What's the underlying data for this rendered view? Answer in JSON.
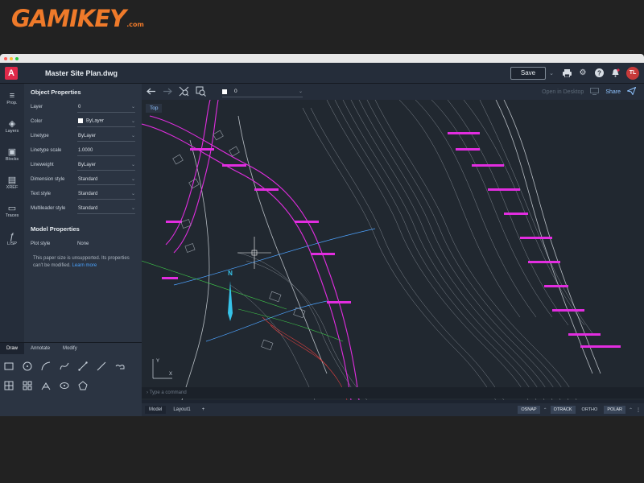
{
  "brand": {
    "logo_main": "GAMIKEY",
    "logo_suffix": ".com"
  },
  "header": {
    "title": "Master Site Plan.dwg",
    "save_label": "Save",
    "save_caret": "⌄",
    "avatar_initials": "TL"
  },
  "rail": {
    "items": [
      {
        "label": "Prop.",
        "icon": "≡"
      },
      {
        "label": "Layers",
        "icon": "◈"
      },
      {
        "label": "Blocks",
        "icon": "▣"
      },
      {
        "label": "XREF",
        "icon": "▤"
      },
      {
        "label": "Traces",
        "icon": "▭"
      },
      {
        "label": "LISP",
        "icon": "ƒ"
      }
    ]
  },
  "properties": {
    "object_title": "Object Properties",
    "rows": [
      {
        "label": "Layer",
        "value": "0"
      },
      {
        "label": "Color",
        "value": "ByLayer"
      },
      {
        "label": "Linetype",
        "value": "ByLayer"
      },
      {
        "label": "Linetype scale",
        "value": "1.0000"
      },
      {
        "label": "Lineweight",
        "value": "ByLayer"
      },
      {
        "label": "Dimension style",
        "value": "Standard"
      },
      {
        "label": "Text style",
        "value": "Standard"
      },
      {
        "label": "Multileader style",
        "value": "Standard"
      }
    ],
    "model_title": "Model Properties",
    "plot_style_label": "Plot style",
    "plot_style_value": "None",
    "note_text": "This paper size is unsupported. Its properties can't be modified.",
    "note_link": "Learn more"
  },
  "draw_panel": {
    "tabs": [
      "Draw",
      "Annotate",
      "Modify"
    ],
    "active_tab": "Draw"
  },
  "viewport": {
    "layer_value": "0",
    "open_desktop": "Open in Desktop",
    "share": "Share",
    "view_label": "Top",
    "north_label": "N",
    "axis_y": "Y",
    "axis_x": "X"
  },
  "command": {
    "placeholder": "Type a command"
  },
  "bottom_bar": {
    "tabs": [
      "Model",
      "Layout1"
    ],
    "add": "+",
    "toggles": [
      "OSNAP",
      "OTRACK",
      "ORTHO",
      "POLAR"
    ],
    "more": "⋮"
  },
  "colors": {
    "accent": "#e0294a",
    "link": "#4aa3ff",
    "drawing_magenta": "#e22de0",
    "drawing_lines": "#9aa2ab",
    "logo": "#ef7a2a"
  }
}
